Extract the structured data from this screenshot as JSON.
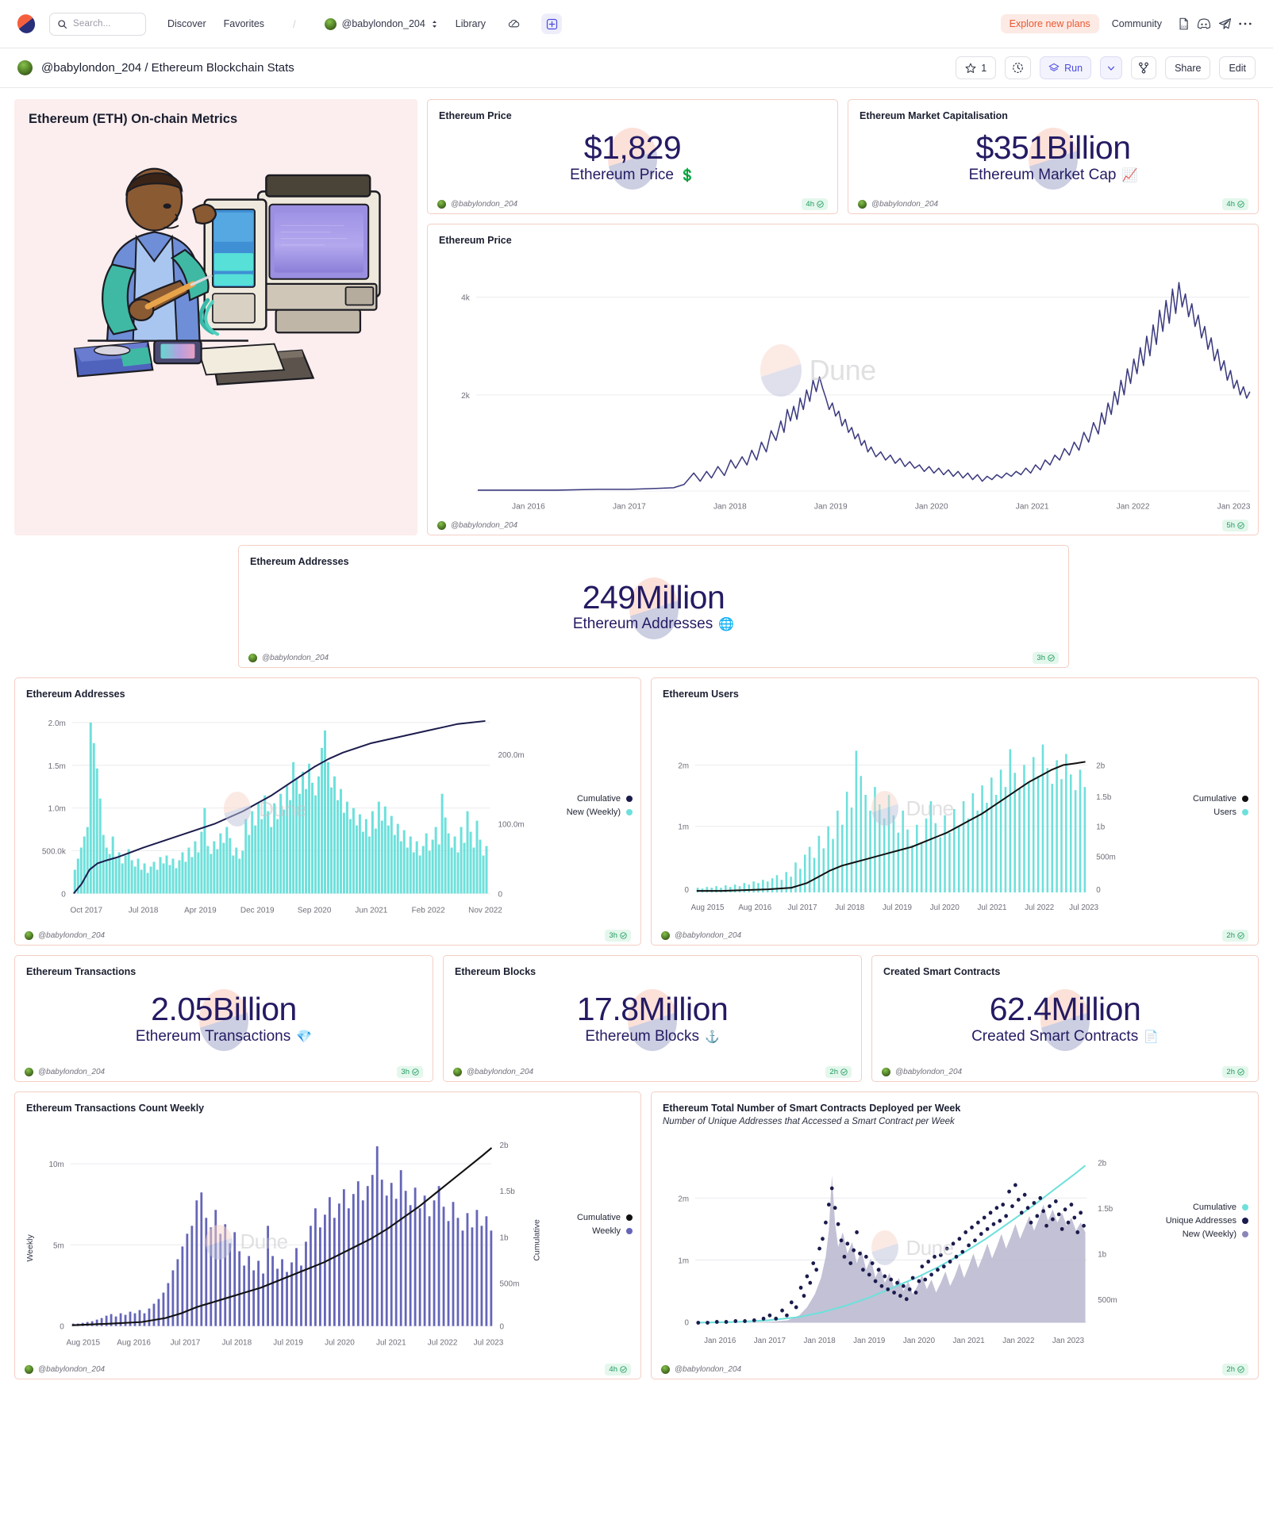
{
  "nav": {
    "search_placeholder": "Search...",
    "links": [
      {
        "label": "Discover"
      },
      {
        "label": "Favorites"
      }
    ],
    "user": "@babylondon_204",
    "library": "Library",
    "plans": "Explore new plans",
    "community": "Community",
    "icons": [
      "docs-icon",
      "discord-icon",
      "telegram-icon",
      "more-icon"
    ]
  },
  "header": {
    "title": "@babylondon_204 / Ethereum Blockchain Stats",
    "star_count": "1",
    "run": "Run",
    "share": "Share",
    "edit": "Edit"
  },
  "hero": {
    "title": "Ethereum (ETH) On-chain Metrics"
  },
  "author": "@babylondon_204",
  "counters": [
    {
      "title": "Ethereum Price",
      "value": "$1,829",
      "label": "Ethereum Price",
      "icon": "💲",
      "freshness": "4h"
    },
    {
      "title": "Ethereum Market Capitalisation",
      "value": "$351Billion",
      "label": "Ethereum Market Cap",
      "icon": "📈",
      "freshness": "4h"
    },
    {
      "title": "Ethereum Addresses",
      "value": "249Million",
      "label": "Ethereum Addresses",
      "icon": "🌐",
      "freshness": "3h"
    },
    {
      "title": "Ethereum Transactions",
      "value": "2.05Billion",
      "label": "Ethereum Transactions",
      "icon": "💎",
      "freshness": "3h"
    },
    {
      "title": "Ethereum Blocks",
      "value": "17.8Million",
      "label": "Ethereum Blocks",
      "icon": "⚓",
      "freshness": "2h"
    },
    {
      "title": "Created Smart Contracts",
      "value": "62.4Million",
      "label": "Created Smart Contracts",
      "icon": "📄",
      "freshness": "2h"
    }
  ],
  "charts": {
    "price": {
      "title": "Ethereum Price",
      "freshness": "5h"
    },
    "addresses": {
      "title": "Ethereum Addresses",
      "freshness": "3h"
    },
    "users": {
      "title": "Ethereum Users",
      "freshness": "2h"
    },
    "txcount": {
      "title": "Ethereum Transactions Count Weekly",
      "freshness": "4h"
    },
    "contracts": {
      "title": "Ethereum Total Number of Smart Contracts Deployed per Week",
      "subtitle": "Number of Unique Addresses that Accessed a Smart Contract per Week",
      "freshness": "2h"
    }
  },
  "chart_data": [
    {
      "id": "eth-price",
      "type": "line",
      "title": "Ethereum Price",
      "xlabel": "",
      "ylabel": "",
      "ylim": [
        0,
        5000
      ],
      "yticks": [
        "2k",
        "4k"
      ],
      "ytick_values": [
        2000,
        4000
      ],
      "xticks": [
        "Jan 2016",
        "Jan 2017",
        "Jan 2018",
        "Jan 2019",
        "Jan 2020",
        "Jan 2021",
        "Jan 2022",
        "Jan 2023"
      ],
      "grid": true,
      "series": [
        {
          "name": "Price",
          "color": "#3b3a7e",
          "x": [
            "2015-08",
            "2016-01",
            "2016-06",
            "2017-01",
            "2017-04",
            "2017-06",
            "2017-09",
            "2018-01",
            "2018-02",
            "2018-05",
            "2018-08",
            "2018-12",
            "2019-06",
            "2019-12",
            "2020-03",
            "2020-08",
            "2020-12",
            "2021-02",
            "2021-05",
            "2021-07",
            "2021-11",
            "2022-01",
            "2022-04",
            "2022-06",
            "2022-09",
            "2022-11",
            "2023-02",
            "2023-04",
            "2023-07"
          ],
          "values": [
            1,
            1,
            12,
            8,
            50,
            330,
            300,
            1380,
            840,
            700,
            280,
            85,
            320,
            130,
            130,
            400,
            740,
            1800,
            4100,
            2100,
            4800,
            2400,
            3000,
            1050,
            1600,
            1200,
            1650,
            1900,
            1829
          ]
        }
      ]
    },
    {
      "id": "eth-addresses",
      "type": "bar+line",
      "title": "Ethereum Addresses",
      "ylabel_left": "",
      "ylabel_right": "",
      "yticks_left": [
        "0",
        "500.0k",
        "1.0m",
        "1.5m",
        "2.0m"
      ],
      "ytick_left_values": [
        0,
        500000,
        1000000,
        1500000,
        2000000
      ],
      "yticks_right": [
        "0",
        "100.0m",
        "200.0m"
      ],
      "ytick_right_values": [
        0,
        100000000,
        200000000
      ],
      "xticks": [
        "Oct 2017",
        "Jul 2018",
        "Apr 2019",
        "Dec 2019",
        "Sep 2020",
        "Jun 2021",
        "Feb 2022",
        "Nov 2022"
      ],
      "legend": [
        {
          "name": "Cumulative",
          "color": "#1b1b4d",
          "marker": "line"
        },
        {
          "name": "New (Weekly)",
          "color": "#6ee0db",
          "marker": "bar"
        }
      ],
      "series": [
        {
          "name": "New (Weekly)",
          "color": "#6ee0db",
          "peak": 2000000,
          "typical_range": [
            300000,
            1200000
          ]
        },
        {
          "name": "Cumulative",
          "color": "#1b1b4d",
          "start": 0,
          "end": 249000000
        }
      ]
    },
    {
      "id": "eth-users",
      "type": "bar+line",
      "title": "Ethereum Users",
      "yticks_left": [
        "0",
        "1m",
        "2m"
      ],
      "ytick_left_values": [
        0,
        1000000,
        2000000
      ],
      "yticks_right": [
        "0",
        "500m",
        "1b",
        "1.5b",
        "2b"
      ],
      "ytick_right_values": [
        0,
        500000000,
        1000000000,
        1500000000,
        2000000000
      ],
      "xticks": [
        "Aug 2015",
        "Aug 2016",
        "Jul 2017",
        "Jul 2018",
        "Jul 2019",
        "Jul 2020",
        "Jul 2021",
        "Jul 2022",
        "Jul 2023"
      ],
      "legend": [
        {
          "name": "Cumulative",
          "color": "#111111",
          "marker": "line"
        },
        {
          "name": "Users",
          "color": "#6ee0db",
          "marker": "bar"
        }
      ],
      "series": [
        {
          "name": "Users",
          "color": "#6ee0db",
          "peak": 2600000
        },
        {
          "name": "Cumulative",
          "color": "#111111",
          "start": 0,
          "end": 2000000000
        }
      ]
    },
    {
      "id": "eth-tx-weekly",
      "type": "bar+line",
      "title": "Ethereum Transactions Count Weekly",
      "ylabel_left": "Weekly",
      "ylabel_right": "Cumulative",
      "yticks_left": [
        "0",
        "5m",
        "10m"
      ],
      "ytick_left_values": [
        0,
        5000000,
        10000000
      ],
      "yticks_right": [
        "0",
        "500m",
        "1b",
        "1.5b",
        "2b"
      ],
      "ytick_right_values": [
        0,
        500000000,
        1000000000,
        1500000000,
        2000000000
      ],
      "xticks": [
        "Aug 2015",
        "Aug 2016",
        "Jul 2017",
        "Jul 2018",
        "Jul 2019",
        "Jul 2020",
        "Jul 2021",
        "Jul 2022",
        "Jul 2023"
      ],
      "legend": [
        {
          "name": "Cumulative",
          "color": "#111111",
          "marker": "line"
        },
        {
          "name": "Weekly",
          "color": "#6565b8",
          "marker": "bar"
        }
      ],
      "series": [
        {
          "name": "Weekly",
          "color": "#6565b8",
          "peak": 11500000
        },
        {
          "name": "Cumulative",
          "color": "#111111",
          "start": 0,
          "end": 2050000000
        }
      ]
    },
    {
      "id": "eth-contracts-weekly",
      "type": "area+scatter+line",
      "title": "Ethereum Total Number of Smart Contracts Deployed per Week",
      "subtitle": "Number of Unique Addresses that Accessed a Smart Contract per Week",
      "yticks_left": [
        "0",
        "1m",
        "2m"
      ],
      "ytick_left_values": [
        0,
        1000000,
        2000000
      ],
      "yticks_right": [
        "500m",
        "1b",
        "1.5b",
        "2b"
      ],
      "ytick_right_values": [
        500000000,
        1000000000,
        1500000000,
        2000000000
      ],
      "xticks": [
        "Jan 2016",
        "Jan 2017",
        "Jan 2018",
        "Jan 2019",
        "Jan 2020",
        "Jan 2021",
        "Jan 2022",
        "Jan 2023"
      ],
      "legend": [
        {
          "name": "Cumulative",
          "color": "#6ee0db",
          "marker": "line"
        },
        {
          "name": "Unique Addresses",
          "color": "#1b1b4d",
          "marker": "scatter"
        },
        {
          "name": "New (Weekly)",
          "color": "#8a86b8",
          "marker": "area"
        }
      ],
      "series": [
        {
          "name": "New (Weekly)",
          "color": "#b6b3cc",
          "peak": 2600000
        },
        {
          "name": "Unique Addresses",
          "color": "#1b1b4d",
          "peak": 2400000
        },
        {
          "name": "Cumulative",
          "color": "#6ee0db",
          "start": 0,
          "end": 2000000000
        }
      ]
    }
  ]
}
